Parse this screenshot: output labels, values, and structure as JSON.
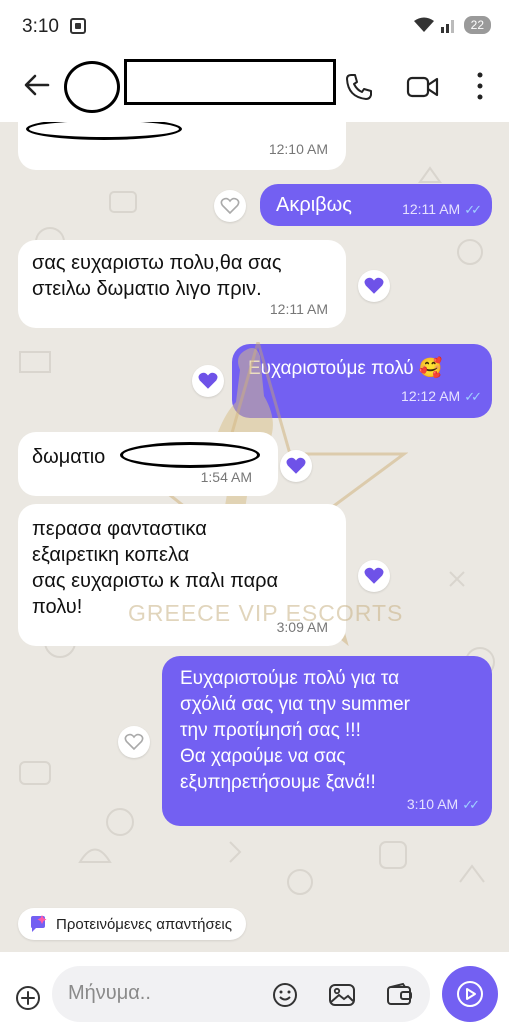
{
  "status_bar": {
    "time": "3:10",
    "battery": "22"
  },
  "header": {
    "contact_name": ""
  },
  "messages": [
    {
      "id": "m1",
      "time": "12:10 AM"
    },
    {
      "id": "m2",
      "text": "Ακριβως",
      "time": "12:11 AM"
    },
    {
      "id": "m3",
      "line1": "σας ευχαριστω πολυ,θα σας",
      "line2": "στειλω δωματιο λιγο πριν.",
      "time": "12:11 AM"
    },
    {
      "id": "m4",
      "text": "Ευχαριστούμε πολύ 🥰",
      "time": "12:12 AM"
    },
    {
      "id": "m5",
      "text": "δωματιο",
      "time": "1:54 AM"
    },
    {
      "id": "m6",
      "line1": "περασα φανταστικα",
      "line2": "εξαιρετικη κοπελα",
      "line3": "σας ευχαριστω κ παλι παρα",
      "line4": "πολυ!",
      "time": "3:09 AM"
    },
    {
      "id": "m7",
      "line1": "Ευχαριστούμε πολύ για τα",
      "line2": "σχόλιά σας για την summer",
      "line3": "την προτίμησή σας !!!",
      "line4": "Θα χαρούμε να σας",
      "line5": "εξυπηρετήσουμε ξανά!!",
      "time": "3:10 AM"
    }
  ],
  "watermark": {
    "letters": "VIP",
    "text": "GREECE VIP ESCORTS"
  },
  "suggestions": {
    "label": "Προτεινόμενες απαντήσεις"
  },
  "composer": {
    "placeholder": "Μήνυμα.."
  },
  "colors": {
    "accent": "#7360f2",
    "chat_bg": "#ebe8e2",
    "incoming": "#ffffff"
  }
}
